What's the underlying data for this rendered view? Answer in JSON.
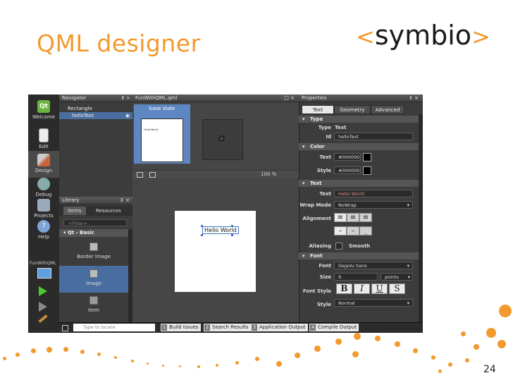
{
  "slide": {
    "title": "QML designer",
    "logo": {
      "open": "<",
      "word": "symbio",
      "close": ">"
    },
    "page_number": "24",
    "accent_color": "#f29a2e"
  },
  "modes": [
    {
      "label": "Welcome",
      "icon": "qt-logo-icon"
    },
    {
      "label": "Edit",
      "icon": "edit-document-icon"
    },
    {
      "label": "Design",
      "icon": "design-pen-icon",
      "active": true
    },
    {
      "label": "Debug",
      "icon": "bug-icon"
    },
    {
      "label": "Projects",
      "icon": "wrench-icon"
    },
    {
      "label": "Help",
      "icon": "help-icon"
    }
  ],
  "project_label": "FunWithQML",
  "navigator": {
    "title": "Navigator",
    "tree": [
      "Rectangle",
      "helloText"
    ]
  },
  "document_title": "FunWithQML.qml",
  "states": {
    "base_label": "base state",
    "thumb_text": "Hello World"
  },
  "canvas": {
    "zoom": "100 %",
    "item_text": "Hello World"
  },
  "library": {
    "title": "Library",
    "tabs": [
      "Items",
      "Resources"
    ],
    "filter_placeholder": "<Filter>",
    "category": "Qt - Basic",
    "items": [
      "Border Image",
      "Image",
      "Item"
    ]
  },
  "properties": {
    "title": "Properties",
    "tabs": [
      "Text",
      "Geometry",
      "Advanced"
    ],
    "sections": {
      "type": "Type",
      "color": "Color",
      "text": "Text",
      "font": "Font"
    },
    "type_label": "Type",
    "type_value": "Text",
    "id_label": "Id",
    "id_value": "helloText",
    "color_text_label": "Text",
    "color_text_value": "#000000",
    "color_style_label": "Style",
    "color_style_value": "#000000",
    "text_label": "Text",
    "text_value": "Hello World",
    "wrap_label": "Wrap Mode",
    "wrap_value": "NoWrap",
    "alignment_label": "Alignment",
    "aliasing_label": "Aliasing",
    "smooth_label": "Smooth",
    "font_label": "Font",
    "font_value": "DejaVu Sans",
    "size_label": "Size",
    "size_value": "9",
    "size_unit": "points",
    "font_style_label": "Font Style",
    "font_style_buttons": [
      "B",
      "I",
      "U",
      "S"
    ],
    "style_label": "Style",
    "style_value": "Normal"
  },
  "statusbar": {
    "locate_placeholder": "Type to locate",
    "buttons": [
      {
        "n": "1",
        "label": "Build Issues"
      },
      {
        "n": "2",
        "label": "Search Results"
      },
      {
        "n": "3",
        "label": "Application Output"
      },
      {
        "n": "4",
        "label": "Compile Output"
      }
    ]
  }
}
